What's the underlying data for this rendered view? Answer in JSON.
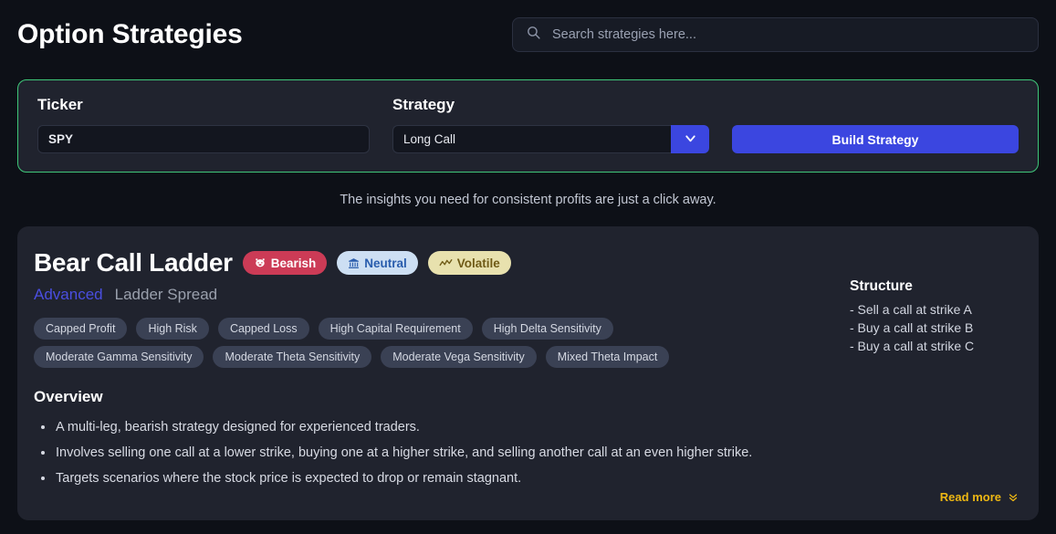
{
  "header": {
    "title": "Option Strategies",
    "search": {
      "placeholder": "Search strategies here...",
      "value": "",
      "icon": "search-icon"
    }
  },
  "builder": {
    "border_color": "#3fc77a",
    "ticker": {
      "label": "Ticker",
      "value": "SPY"
    },
    "strategy": {
      "label": "Strategy",
      "value": "Long Call",
      "chevron_icon": "chevron-down-icon"
    },
    "build_button": {
      "label": "Build Strategy",
      "color": "#3b46e0"
    }
  },
  "tagline": "The insights you need for consistent profits are just a click away.",
  "strategy_card": {
    "name": "Bear Call Ladder",
    "badges": [
      {
        "label": "Bearish",
        "icon": "bear-face-icon",
        "bg": "#cc3b56",
        "fg": "#ffffff"
      },
      {
        "label": "Neutral",
        "icon": "bank-icon",
        "bg": "#cddff3",
        "fg": "#2a5dad"
      },
      {
        "label": "Volatile",
        "icon": "wave-chart-icon",
        "bg": "#e8e1ae",
        "fg": "#6f5a16"
      }
    ],
    "level": "Advanced",
    "level_color": "#4a4ee0",
    "family": "Ladder Spread",
    "tags": [
      "Capped Profit",
      "High Risk",
      "Capped Loss",
      "High Capital Requirement",
      "High Delta Sensitivity",
      "Moderate Gamma Sensitivity",
      "Moderate Theta Sensitivity",
      "Moderate Vega Sensitivity",
      "Mixed Theta Impact"
    ],
    "overview": {
      "heading": "Overview",
      "items": [
        "A multi-leg, bearish strategy designed for experienced traders.",
        "Involves selling one call at a lower strike, buying one at a higher strike, and selling another call at an even higher strike.",
        "Targets scenarios where the stock price is expected to drop or remain stagnant."
      ]
    },
    "structure": {
      "heading": "Structure",
      "lines": [
        "- Sell a call at strike A",
        "- Buy a call at strike B",
        "- Buy a call at strike C"
      ]
    },
    "read_more": {
      "label": "Read more",
      "icon": "double-chevron-down-icon",
      "color": "#edb713"
    }
  }
}
